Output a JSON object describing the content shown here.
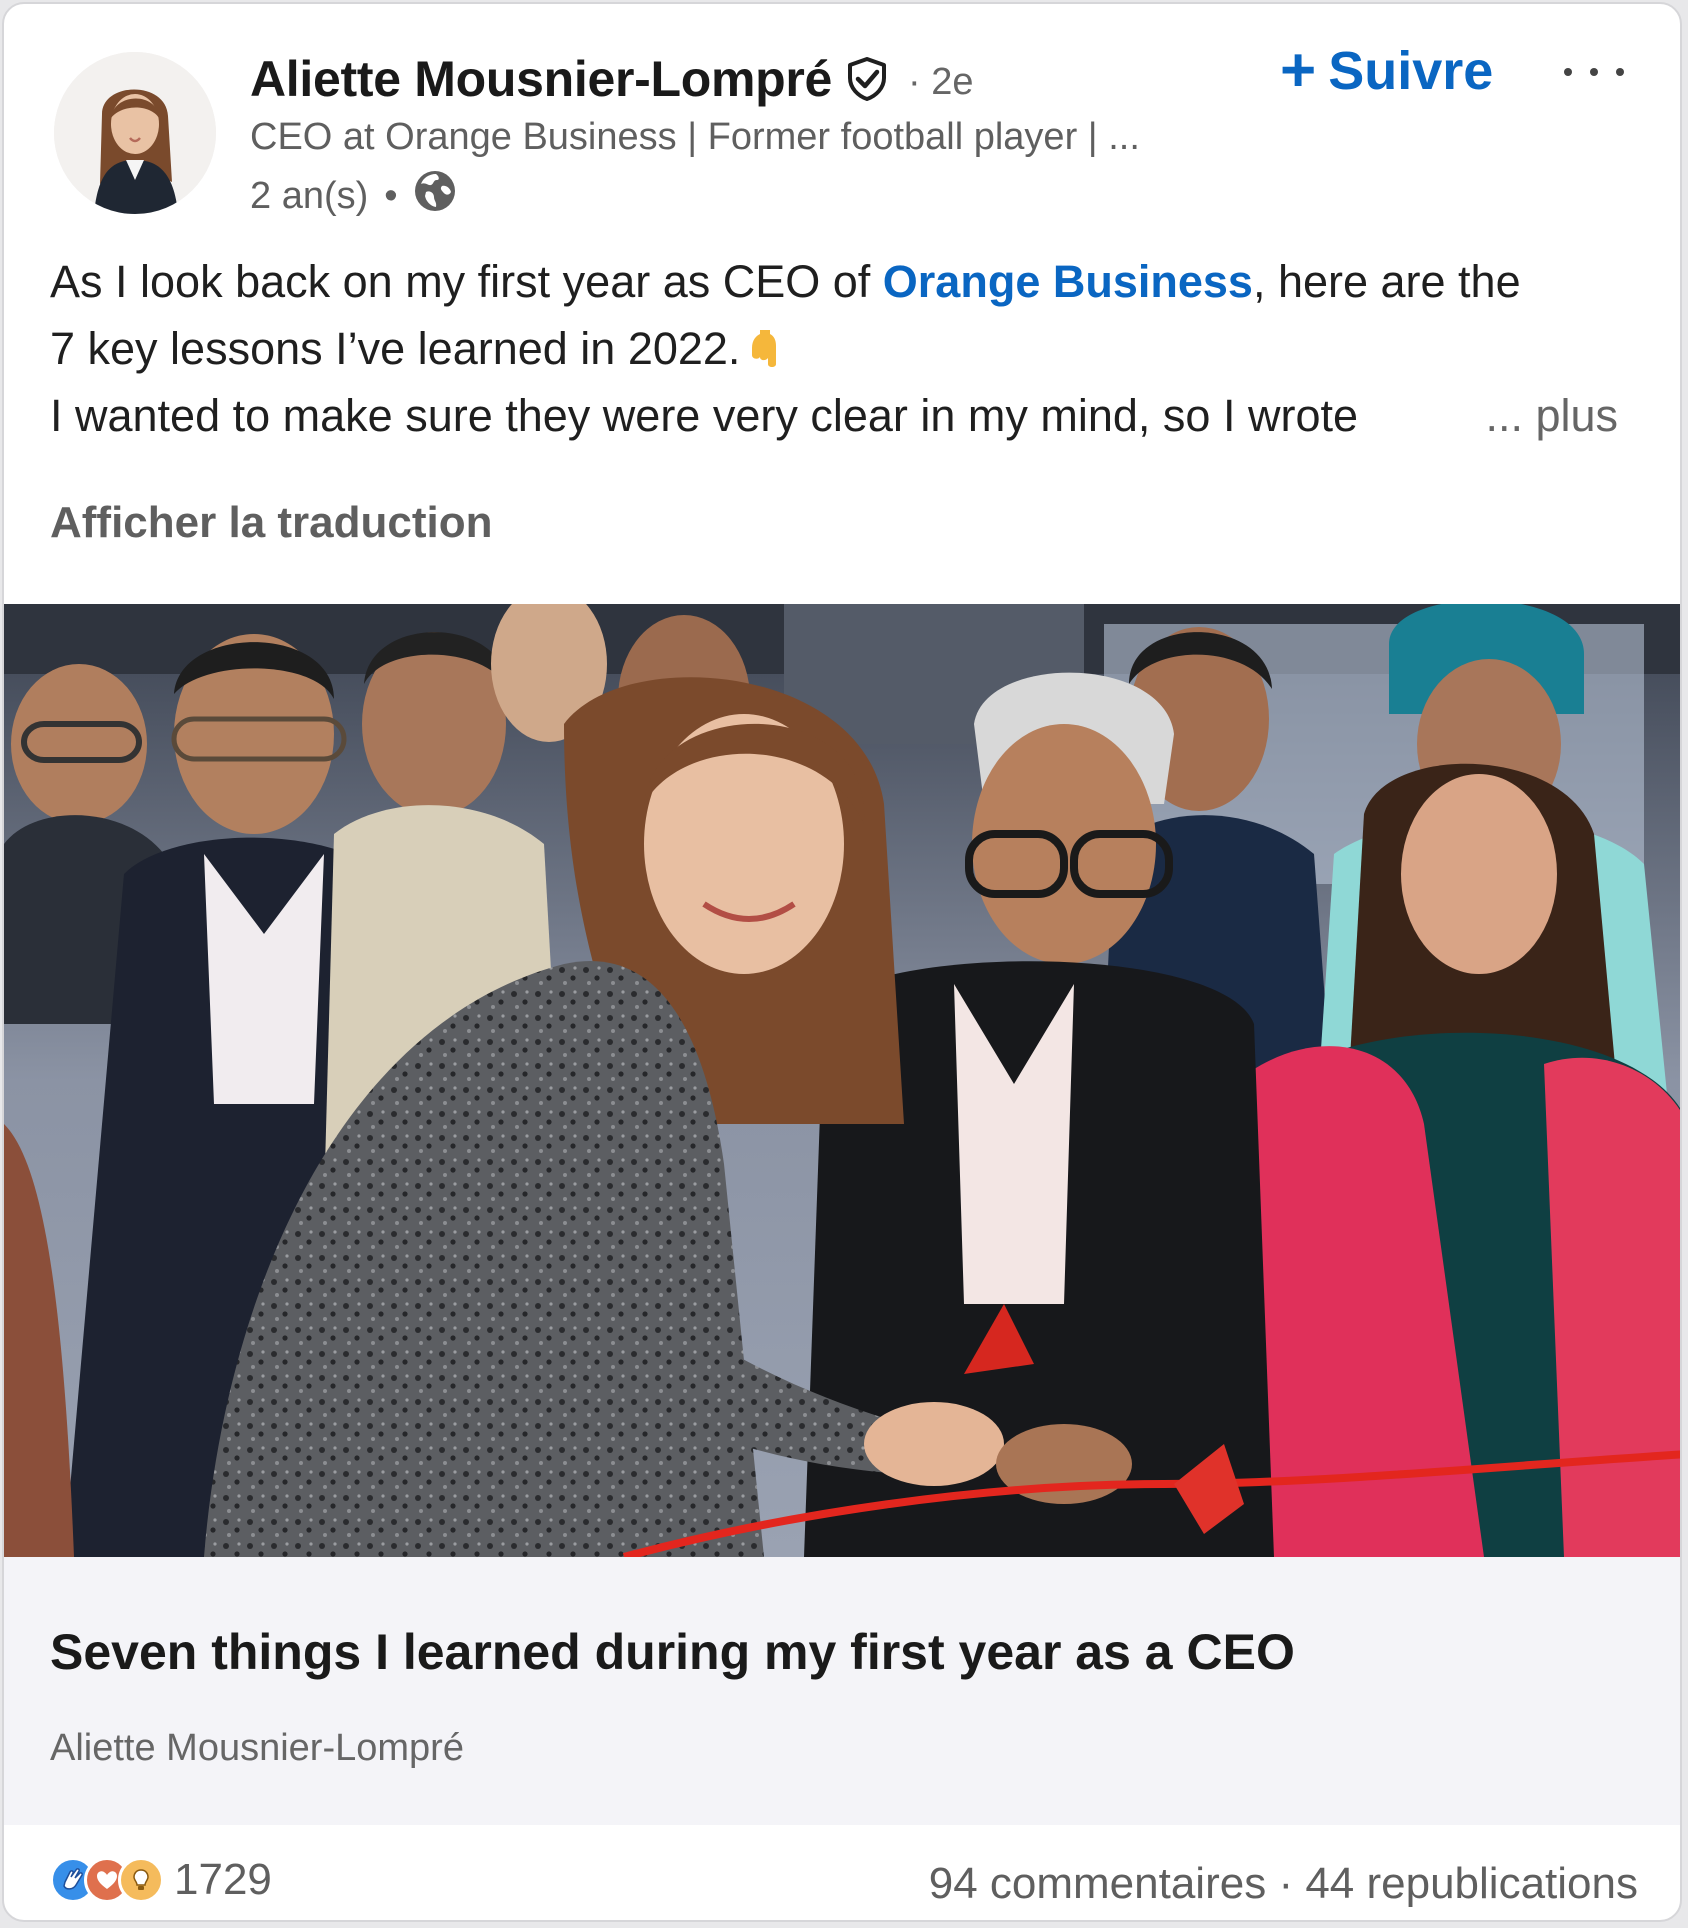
{
  "post": {
    "author": {
      "name": "Aliette Mousnier-Lompré",
      "degree": "· 2e",
      "headline": "CEO at Orange Business | Former football player | ...",
      "age": "2 an(s)",
      "meta_separator": "•",
      "verified_icon": "verified-shield-icon",
      "visibility_icon": "globe-icon"
    },
    "follow_label": "Suivre",
    "follow_icon_glyph": "+",
    "more_icon": "ellipsis-icon",
    "text": {
      "line1_prefix": "As I look back on my first year as CEO of ",
      "line1_mention": "Orange Business",
      "line1_suffix": ", here are the",
      "line2": "7 key lessons I’ve learned in 2022.",
      "line2_emoji": "👇",
      "line3": "I wanted to make sure they were very clear in my mind, so I wrote",
      "see_more": "... plus"
    },
    "translate_label": "Afficher la traduction",
    "article": {
      "title": "Seven things I learned during my first year as a CEO",
      "author": "Aliette Mousnier-Lompré"
    },
    "social": {
      "reaction_icons": [
        "clap-icon",
        "heart-icon",
        "lightbulb-icon"
      ],
      "reaction_count": "1729",
      "comments": "94 commentaires",
      "separator": "·",
      "reposts": "44 republications"
    },
    "colors": {
      "accent": "#0a66c2",
      "secondary_text": "#5f5f5f",
      "article_bg": "#f4f4f8"
    }
  }
}
